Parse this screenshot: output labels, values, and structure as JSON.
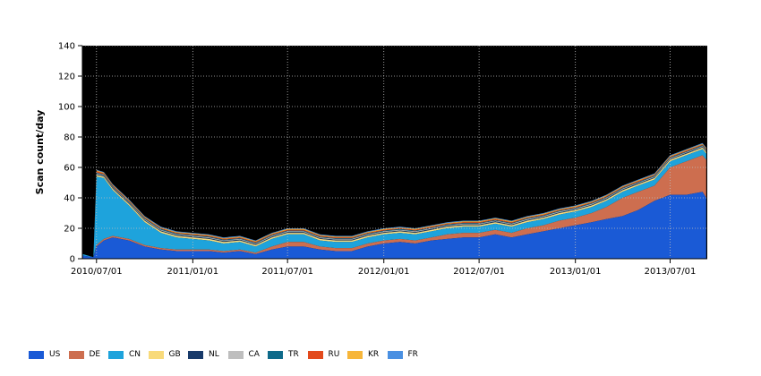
{
  "chart_data": {
    "type": "area",
    "title": "",
    "xlabel": "",
    "ylabel": "Scan count/day",
    "ylim": [
      0,
      140
    ],
    "yticks": [
      0,
      20,
      40,
      60,
      80,
      100,
      120,
      140
    ],
    "xlim": [
      "2010-06-04",
      "2013-09-10"
    ],
    "xticks": [
      {
        "date": "2010-07-01",
        "label": "2010/07/01"
      },
      {
        "date": "2011-01-01",
        "label": "2011/01/01"
      },
      {
        "date": "2011-07-01",
        "label": "2011/07/01"
      },
      {
        "date": "2012-01-01",
        "label": "2012/01/01"
      },
      {
        "date": "2012-07-01",
        "label": "2012/07/01"
      },
      {
        "date": "2013-01-01",
        "label": "2013/01/01"
      },
      {
        "date": "2013-07-01",
        "label": "2013/07/01"
      }
    ],
    "grid": true,
    "plot_background": "#000000",
    "legend_position": "bottom",
    "x": [
      "2010-06-05",
      "2010-06-25",
      "2010-07-01",
      "2010-07-15",
      "2010-08-01",
      "2010-09-01",
      "2010-10-01",
      "2010-11-01",
      "2010-12-01",
      "2011-01-01",
      "2011-02-01",
      "2011-03-01",
      "2011-04-01",
      "2011-05-01",
      "2011-06-01",
      "2011-07-01",
      "2011-08-01",
      "2011-09-01",
      "2011-10-01",
      "2011-11-01",
      "2011-12-01",
      "2012-01-01",
      "2012-02-01",
      "2012-03-01",
      "2012-04-01",
      "2012-05-01",
      "2012-06-01",
      "2012-07-01",
      "2012-08-01",
      "2012-09-01",
      "2012-10-01",
      "2012-11-01",
      "2012-12-01",
      "2013-01-01",
      "2013-02-01",
      "2013-03-01",
      "2013-04-01",
      "2013-05-01",
      "2013-06-01",
      "2013-07-01",
      "2013-08-01",
      "2013-09-01",
      "2013-09-08"
    ],
    "series": [
      {
        "name": "US",
        "color": "#1a5ad6",
        "values": [
          2,
          1,
          8,
          12,
          14,
          12,
          8,
          6,
          5,
          5,
          5,
          4,
          5,
          3,
          6,
          8,
          8,
          6,
          5,
          5,
          8,
          10,
          11,
          10,
          12,
          13,
          14,
          14,
          16,
          14,
          16,
          18,
          20,
          22,
          24,
          26,
          28,
          32,
          38,
          42,
          42,
          44,
          40
        ]
      },
      {
        "name": "DE",
        "color": "#cd6e4f",
        "values": [
          0,
          0,
          1,
          1,
          1,
          1,
          1,
          1,
          1,
          1,
          1,
          1,
          1,
          1,
          2,
          3,
          3,
          2,
          2,
          2,
          2,
          2,
          2,
          2,
          2,
          3,
          3,
          3,
          3,
          3,
          4,
          4,
          5,
          5,
          6,
          8,
          12,
          12,
          10,
          18,
          22,
          24,
          25
        ]
      },
      {
        "name": "CN",
        "color": "#1ea3dc",
        "values": [
          1,
          0,
          45,
          40,
          30,
          22,
          15,
          10,
          8,
          7,
          6,
          5,
          5,
          4,
          5,
          5,
          5,
          4,
          4,
          4,
          4,
          4,
          4,
          4,
          4,
          4,
          4,
          4,
          4,
          4,
          4,
          4,
          4,
          4,
          4,
          4,
          4,
          4,
          4,
          4,
          4,
          4,
          4
        ]
      },
      {
        "name": "GB",
        "color": "#f8da7a",
        "values": [
          0,
          0,
          1,
          1,
          1,
          1,
          1,
          1,
          1,
          1,
          1,
          1,
          1,
          1,
          1,
          1,
          1,
          1,
          1,
          1,
          1,
          1,
          1,
          1,
          1,
          1,
          1,
          1,
          1,
          1,
          1,
          1,
          1,
          1,
          1,
          1,
          1,
          1,
          1,
          1,
          1,
          1,
          1
        ]
      },
      {
        "name": "NL",
        "color": "#183a6a",
        "values": [
          0,
          0,
          0.5,
          0.5,
          0.5,
          0.5,
          0.5,
          0.5,
          0.5,
          0.5,
          0.5,
          0.5,
          0.5,
          0.5,
          0.5,
          0.5,
          0.5,
          0.5,
          0.5,
          0.5,
          0.5,
          0.5,
          0.5,
          0.5,
          0.5,
          0.5,
          0.5,
          0.5,
          0.5,
          0.5,
          0.5,
          0.5,
          0.5,
          0.5,
          0.5,
          0.5,
          0.5,
          0.5,
          0.5,
          0.5,
          0.5,
          0.5,
          0.5
        ]
      },
      {
        "name": "CA",
        "color": "#bebebe",
        "values": [
          0,
          0,
          0.5,
          0.5,
          0.5,
          0.5,
          0.5,
          0.5,
          0.5,
          0.5,
          0.5,
          0.5,
          0.5,
          0.5,
          0.5,
          0.5,
          0.5,
          0.5,
          0.5,
          0.5,
          0.5,
          0.5,
          0.5,
          0.5,
          0.5,
          0.5,
          0.5,
          0.5,
          0.5,
          0.5,
          0.5,
          0.5,
          0.5,
          0.5,
          0.5,
          0.5,
          0.5,
          0.5,
          0.5,
          0.5,
          0.5,
          0.5,
          0.5
        ]
      },
      {
        "name": "TR",
        "color": "#0e6a8a",
        "values": [
          0,
          0,
          0.5,
          0.5,
          0.5,
          0.5,
          0.5,
          0.5,
          0.5,
          0.5,
          0.5,
          0.5,
          0.5,
          0.5,
          0.5,
          0.5,
          0.5,
          0.5,
          0.5,
          0.5,
          0.5,
          0.5,
          0.5,
          0.5,
          0.5,
          0.5,
          0.5,
          0.5,
          0.5,
          0.5,
          0.5,
          0.5,
          0.5,
          0.5,
          0.5,
          0.5,
          0.5,
          0.5,
          0.5,
          0.5,
          0.5,
          0.5,
          0.5
        ]
      },
      {
        "name": "RU",
        "color": "#e34a1c",
        "values": [
          0,
          0,
          1,
          0.5,
          0.5,
          0.5,
          0.5,
          0.5,
          0.5,
          0.5,
          0.5,
          0.5,
          0.5,
          0.5,
          0.5,
          0.5,
          0.5,
          0.5,
          0.5,
          0.5,
          0.5,
          0.5,
          0.5,
          0.5,
          0.5,
          0.5,
          0.5,
          0.5,
          0.5,
          0.5,
          0.5,
          0.5,
          0.5,
          0.5,
          0.5,
          0.5,
          0.5,
          0.5,
          0.5,
          0.5,
          0.5,
          0.5,
          0.5
        ]
      },
      {
        "name": "KR",
        "color": "#f7b63a",
        "values": [
          0,
          0,
          0.5,
          0.5,
          0.5,
          0.5,
          0.5,
          0.5,
          0.5,
          0.5,
          0.5,
          0.5,
          0.5,
          0.5,
          0.5,
          0.5,
          0.5,
          0.5,
          0.5,
          0.5,
          0.5,
          0.5,
          0.5,
          0.5,
          0.5,
          0.5,
          0.5,
          0.5,
          0.5,
          0.5,
          0.5,
          0.5,
          0.5,
          0.5,
          0.5,
          0.5,
          0.5,
          0.5,
          0.5,
          0.5,
          0.5,
          0.5,
          0.5
        ]
      },
      {
        "name": "FR",
        "color": "#4a90e2",
        "values": [
          0,
          0,
          0.5,
          0.5,
          0.5,
          0.5,
          0.5,
          0.5,
          0.5,
          0.5,
          0.5,
          0.5,
          0.5,
          0.5,
          0.5,
          0.5,
          0.5,
          0.5,
          0.5,
          0.5,
          0.5,
          0.5,
          0.5,
          0.5,
          0.5,
          0.5,
          0.5,
          0.5,
          0.5,
          0.5,
          0.5,
          0.5,
          0.5,
          0.5,
          0.5,
          0.5,
          0.5,
          0.5,
          0.5,
          0.5,
          0.5,
          0.5,
          0.5
        ]
      }
    ]
  }
}
